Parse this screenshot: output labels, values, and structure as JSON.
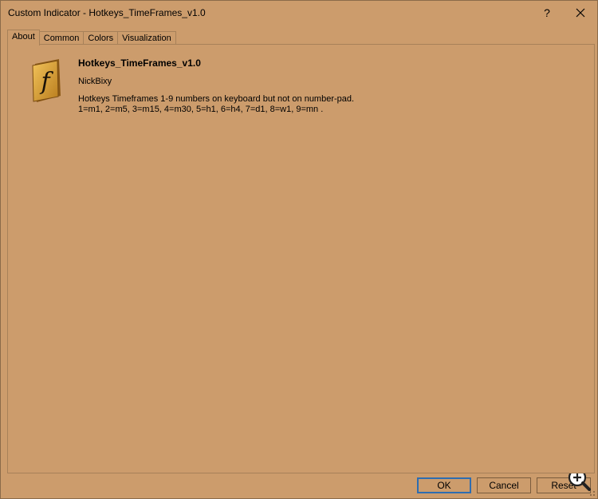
{
  "window": {
    "title": "Custom Indicator - Hotkeys_TimeFrames_v1.0",
    "help_label": "?"
  },
  "tabs": [
    {
      "label": "About"
    },
    {
      "label": "Common"
    },
    {
      "label": "Colors"
    },
    {
      "label": "Visualization"
    }
  ],
  "about": {
    "icon": "function-f-icon",
    "name": "Hotkeys_TimeFrames_v1.0",
    "author": "NickBixy",
    "description_line1": "Hotkeys Timeframes 1-9 numbers on keyboard but not on number-pad.",
    "description_line2": "1=m1, 2=m5, 3=m15, 4=m30, 5=h1, 6=h4, 7=d1, 8=w1, 9=mn ."
  },
  "buttons": {
    "ok": "OK",
    "cancel": "Cancel",
    "reset": "Reset"
  },
  "colors": {
    "background": "#cc9c6c",
    "default_button_border": "#2e6db0",
    "icon_gold": "#d9a23a"
  }
}
